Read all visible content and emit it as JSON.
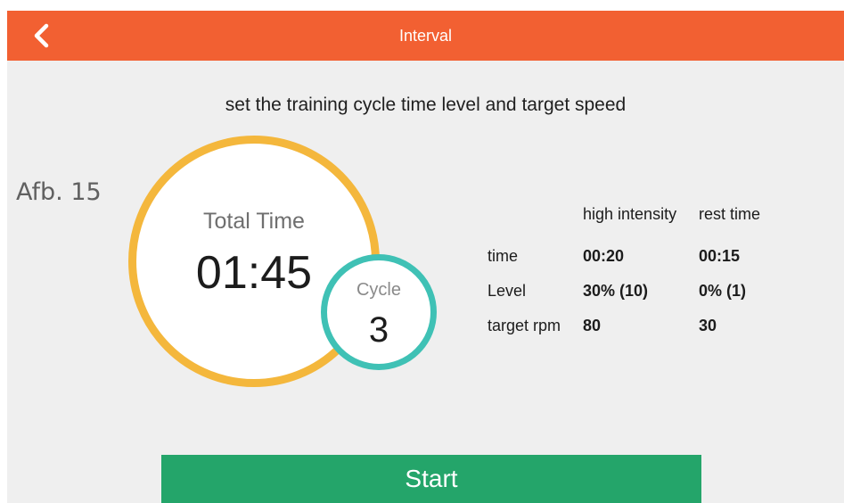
{
  "header": {
    "title": "Interval",
    "back_icon": "chevron-left-icon"
  },
  "instruction": "set the training cycle time level and target speed",
  "figure_label": "Afb. 15",
  "total_time": {
    "label": "Total Time",
    "value": "01:45"
  },
  "cycle": {
    "label": "Cycle",
    "value": "3"
  },
  "params": {
    "columns": [
      "high intensity",
      "rest time"
    ],
    "rows": [
      {
        "label": "time",
        "high": "00:20",
        "rest": "00:15"
      },
      {
        "label": "Level",
        "high": "30% (10)",
        "rest": "0% (1)"
      },
      {
        "label": "target rpm",
        "high": "80",
        "rest": "30"
      }
    ]
  },
  "start_label": "Start",
  "colors": {
    "header": "#f26032",
    "background": "#efefef",
    "total_ring": "#f4b73c",
    "cycle_ring": "#3fc1b5",
    "start_button": "#24a56a"
  }
}
